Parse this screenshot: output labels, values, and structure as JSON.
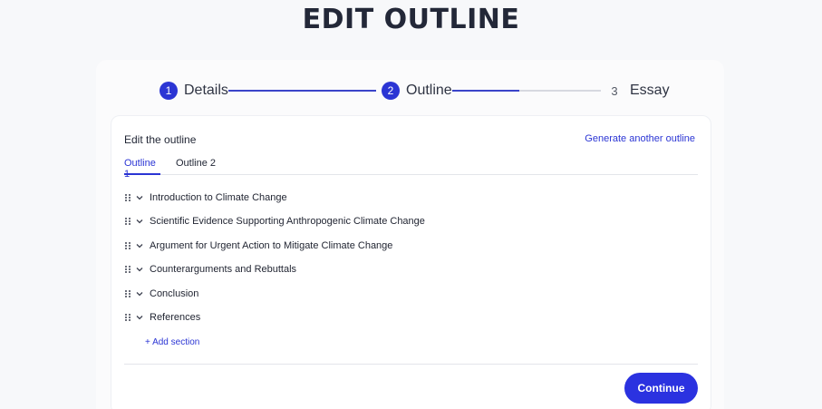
{
  "page": {
    "title": "EDIT OUTLINE"
  },
  "stepper": {
    "steps": [
      {
        "number": "1",
        "label": "Details"
      },
      {
        "number": "2",
        "label": "Outline"
      },
      {
        "number": "3",
        "label": "Essay"
      }
    ],
    "progress": [
      1.0,
      0.45
    ],
    "active_color": "#2b35d4"
  },
  "outline": {
    "heading": "Edit the outline",
    "generate_label": "Generate another outline",
    "tabs": [
      {
        "label": "Outline 1",
        "active": true
      },
      {
        "label": "Outline 2",
        "active": false
      }
    ],
    "sections": [
      "Introduction to Climate Change",
      "Scientific Evidence Supporting Anthropogenic Climate Change",
      "Argument for Urgent Action to Mitigate Climate Change",
      "Counterarguments and Rebuttals",
      "Conclusion",
      "References"
    ],
    "add_section_label": "+ Add section",
    "continue_label": "Continue"
  },
  "icons": {
    "drag": "drag-handle-icon",
    "expand": "chevron-down-icon"
  }
}
